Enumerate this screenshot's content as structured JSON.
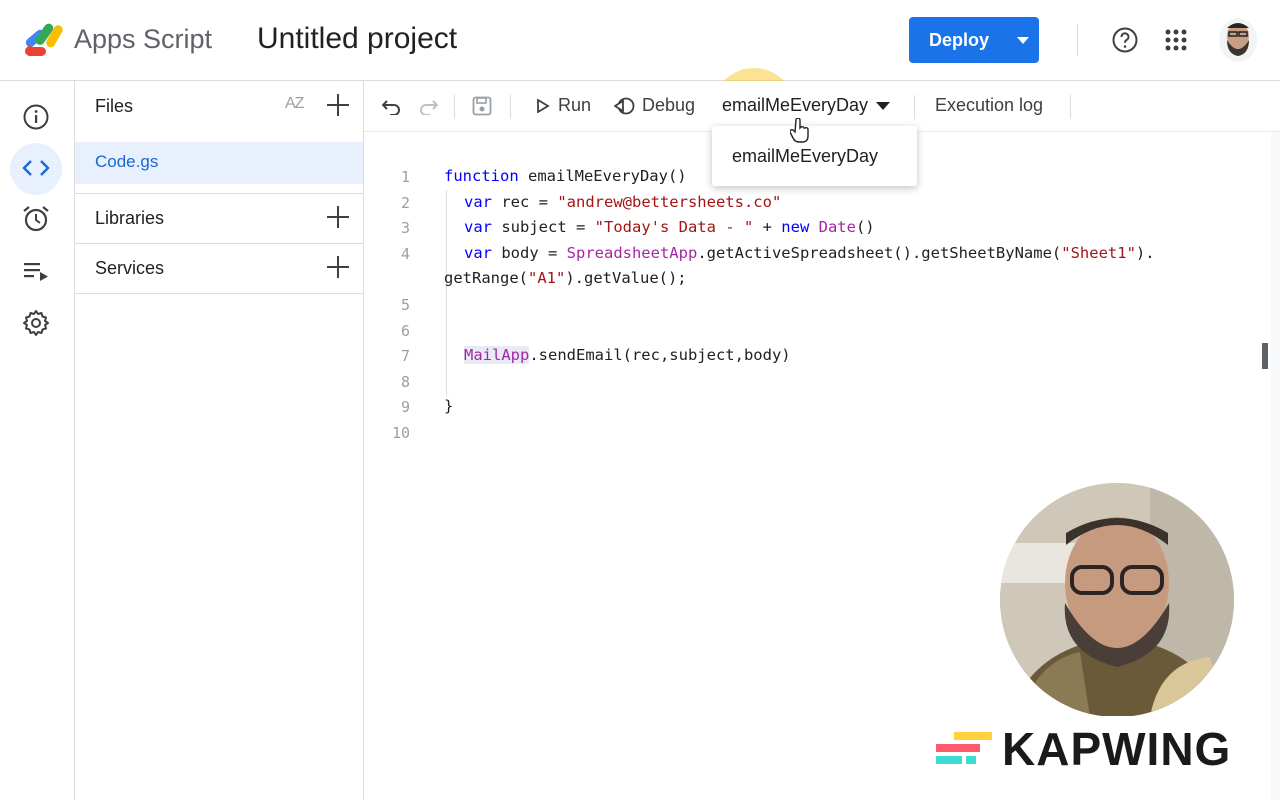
{
  "header": {
    "app_name": "Apps Script",
    "project_title": "Untitled project",
    "deploy_label": "Deploy",
    "brand_color": "#1a73e8",
    "icons": [
      "apps-script-logo",
      "help-icon",
      "apps-grid-icon",
      "avatar"
    ]
  },
  "rail": {
    "items": [
      {
        "name": "overview",
        "icon": "info-icon"
      },
      {
        "name": "editor",
        "icon": "code-icon",
        "active": true
      },
      {
        "name": "triggers",
        "icon": "alarm-clock-icon"
      },
      {
        "name": "executions",
        "icon": "executions-list-icon"
      },
      {
        "name": "settings",
        "icon": "gear-icon"
      }
    ]
  },
  "files_panel": {
    "files_label": "Files",
    "sort_label": "AZ",
    "files": [
      "Code.gs"
    ],
    "libraries_label": "Libraries",
    "services_label": "Services"
  },
  "toolbar": {
    "run_label": "Run",
    "debug_label": "Debug",
    "function_selected": "emailMeEveryDay",
    "execution_log_label": "Execution log"
  },
  "dropdown": {
    "options": [
      "emailMeEveryDay"
    ]
  },
  "editor": {
    "line_numbers": [
      "1",
      "2",
      "3",
      "4",
      "5",
      "6",
      "7",
      "8",
      "9",
      "10"
    ],
    "line1": {
      "kw": "function",
      "rest": " emailMeEveryDay()"
    },
    "line2": {
      "kw": "var",
      "mid": " rec = ",
      "str": "\"andrew@bettersheets.co\""
    },
    "line3": {
      "kw": "var",
      "mid": " subject = ",
      "str": "\"Today's Data - \"",
      "plus": " + ",
      "kw2": "new",
      "cls": " Date",
      "end": "()"
    },
    "line4": {
      "kw": "var",
      "mid": " body = ",
      "cls": "SpreadsheetApp",
      "call": ".getActiveSpreadsheet().getSheetByName(",
      "str": "\"Sheet1\"",
      "end": ")."
    },
    "line4b": {
      "start": "getRange(",
      "str": "\"A1\"",
      "end": ").getValue();"
    },
    "line7": {
      "cls": "MailApp",
      "rest": ".sendEmail(rec,subject,body)"
    },
    "line9": "}"
  },
  "overlay": {
    "watermark": "KAPWING"
  }
}
